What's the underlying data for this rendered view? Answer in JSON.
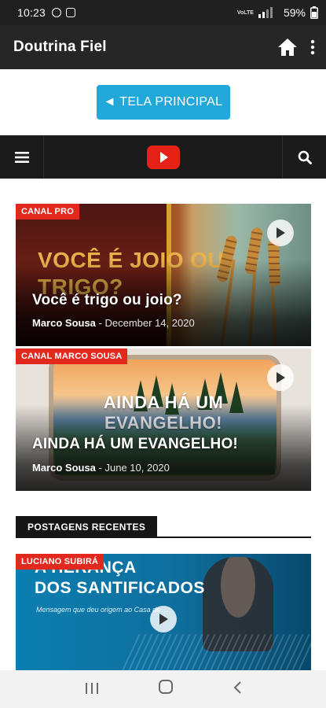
{
  "status_bar": {
    "time": "10:23",
    "battery": "59%"
  },
  "app_bar": {
    "title": "Doutrina Fiel",
    "home_icon": "home-icon",
    "more_icon": "more-vert-icon"
  },
  "main_button": {
    "label": "◄ TELA PRINCIPAL",
    "color": "#21a7d8"
  },
  "nav": {
    "menu_icon": "hamburger-icon",
    "youtube_icon": "youtube-icon",
    "search_icon": "search-icon"
  },
  "featured": [
    {
      "badge": "CANAL PRO",
      "image_text": "VOCÊ É JOIO OU TRIGO?",
      "title": "Você é trigo ou joio?",
      "author": "Marco Sousa",
      "date": "- December 14, 2020"
    },
    {
      "badge": "CANAL MARCO SOUSA",
      "image_text": "AINDA HÁ UM EVANGELHO!",
      "title": "AINDA HÁ UM EVANGELHO!",
      "author": "Marco Sousa",
      "date": "- June 10, 2020"
    }
  ],
  "recent": {
    "heading": "POSTAGENS RECENTES",
    "items": [
      {
        "badge": "LUCIANO SUBIRÁ",
        "image_title_1": "A HERANÇA",
        "image_title_2": "DOS SANTIFICADOS",
        "image_subtitle": "Mensagem que deu origem ao Casa de ..."
      }
    ]
  },
  "colors": {
    "badge_red": "#e3281e",
    "app_bar": "#262626",
    "nav_bar": "#1b1b1b",
    "youtube_red": "#e62117"
  }
}
